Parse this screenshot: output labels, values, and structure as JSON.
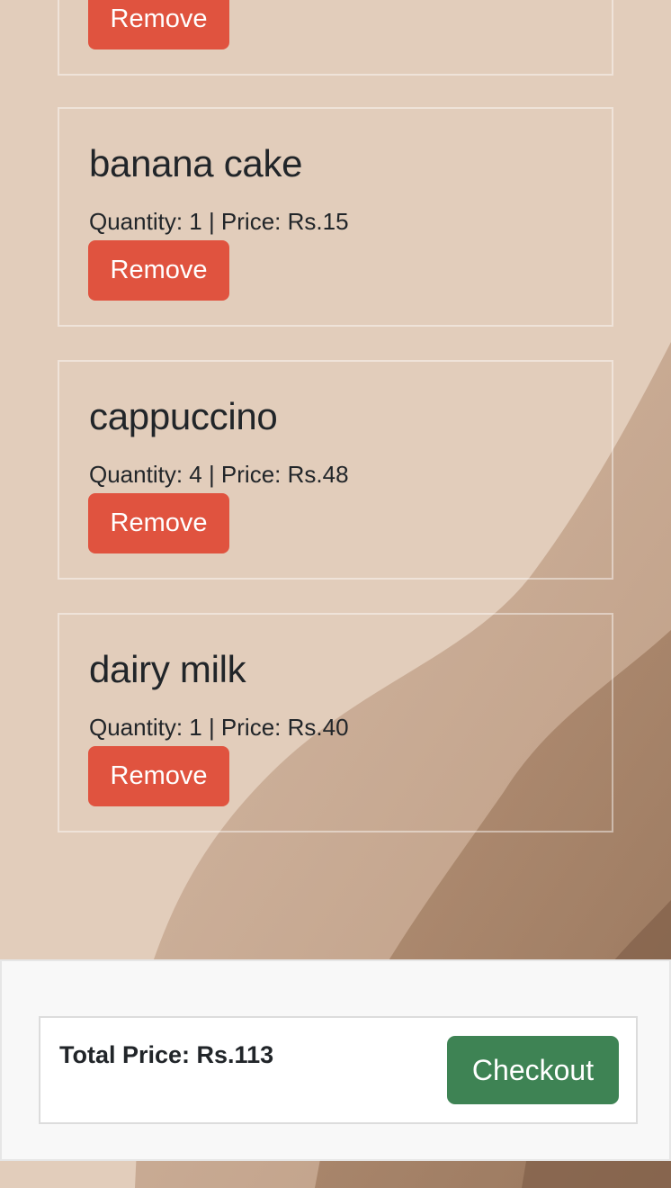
{
  "cart": {
    "items": [
      {
        "name": "",
        "meta": "",
        "remove_label": "Remove"
      },
      {
        "name": "banana cake",
        "meta": "Quantity: 1 | Price: Rs.15",
        "remove_label": "Remove"
      },
      {
        "name": "cappuccino",
        "meta": "Quantity: 4 | Price: Rs.48",
        "remove_label": "Remove"
      },
      {
        "name": "dairy milk",
        "meta": "Quantity: 1 | Price: Rs.40",
        "remove_label": "Remove"
      }
    ]
  },
  "summary": {
    "total_label": "Total Price: Rs.113",
    "checkout_label": "Checkout"
  },
  "colors": {
    "remove_button": "#e0533f",
    "checkout_button": "#3e8354",
    "background": "#e2cdbb"
  }
}
